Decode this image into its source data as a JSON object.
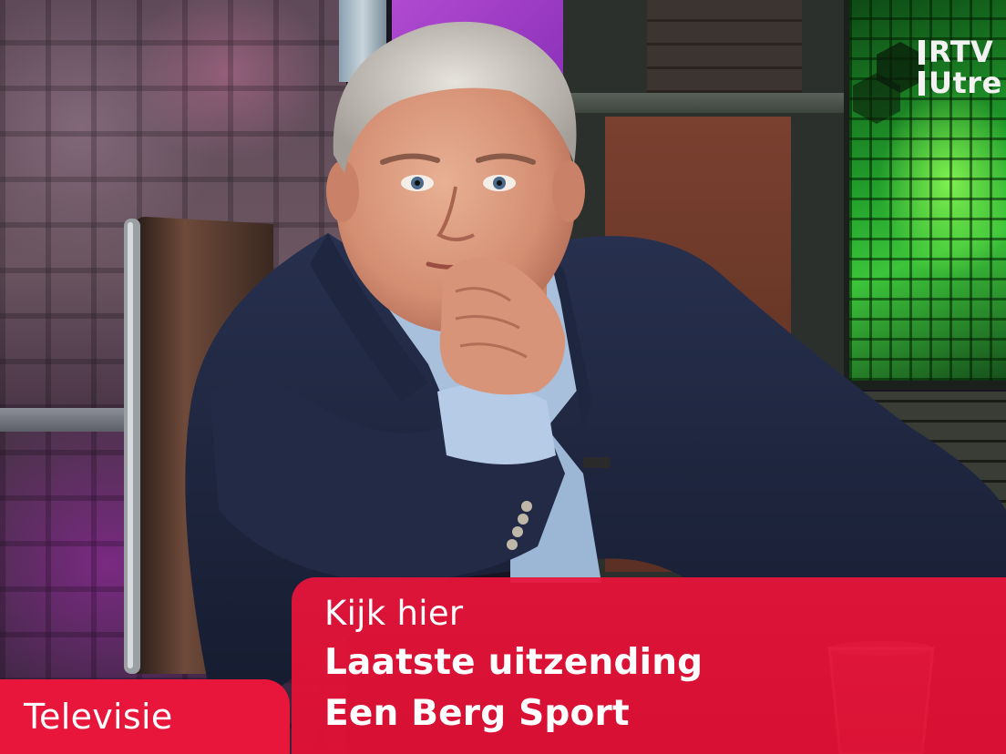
{
  "screen_logo": {
    "line1": "RTV",
    "line2": "Utre"
  },
  "caption": {
    "line1": "Kijk hier",
    "line2": "Laatste uitzending",
    "line3": "Een Berg Sport"
  },
  "category": {
    "label": "Televisie"
  },
  "colors": {
    "caption_background": "#e8163a",
    "caption_text": "#ffffff",
    "screen_green": "#22a02c"
  }
}
